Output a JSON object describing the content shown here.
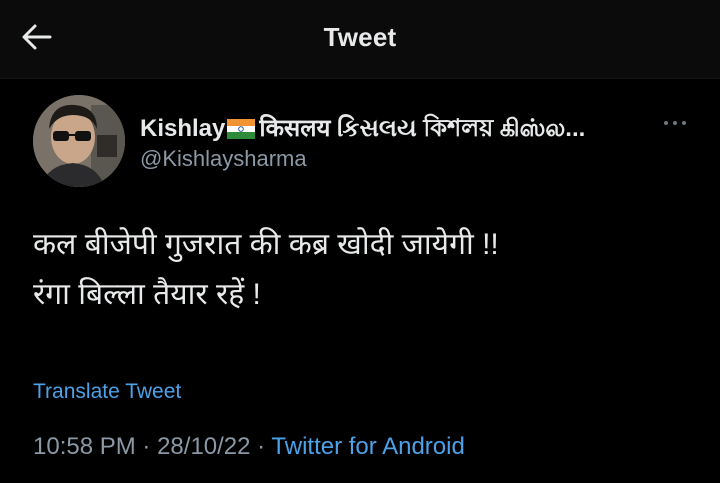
{
  "header": {
    "title": "Tweet",
    "back_icon": "arrow-left-icon"
  },
  "author": {
    "name": "Kishlay",
    "name_suffix": "किसलय કિસલય কিশলয় கிஸ்ல...",
    "flag_icon": "india-flag-icon",
    "handle": "@Kishlaysharma",
    "more_icon": "more-dots-icon"
  },
  "tweet": {
    "lines": [
      "कल बीजेपी गुजरात की कब्र खोदी जायेगी !!",
      "रंगा बिल्ला तैयार रहें !"
    ],
    "translate_label": "Translate Tweet"
  },
  "meta": {
    "time": "10:58 PM",
    "date": "28/10/22",
    "separator": "·",
    "source": "Twitter for Android"
  },
  "colors": {
    "background": "#000000",
    "text": "#e7e9ea",
    "muted": "#8b98a5",
    "link": "#4ca1e8"
  }
}
